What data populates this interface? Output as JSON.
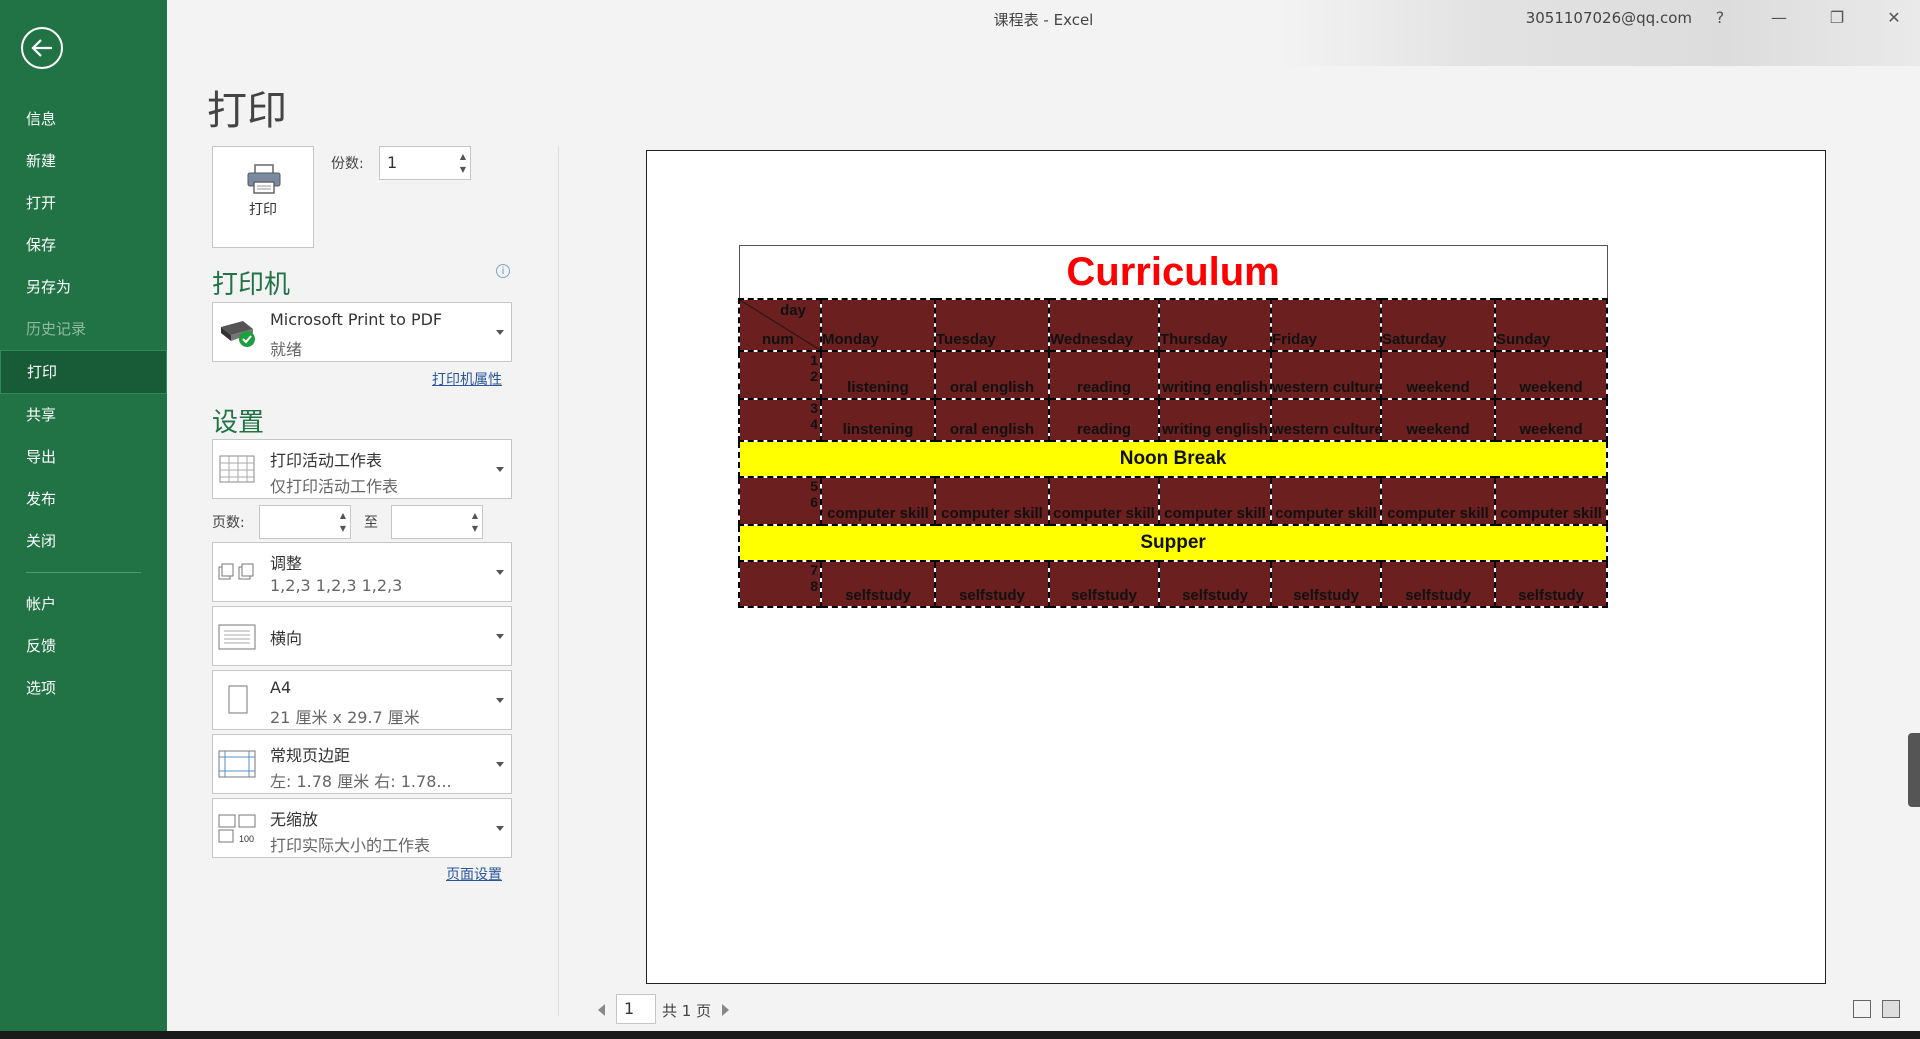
{
  "window": {
    "title": "课程表  -  Excel",
    "user": "3051107026@qq.com",
    "help": "?",
    "minimize": "—",
    "restore": "❐",
    "close": "✕"
  },
  "sidebar": {
    "items": [
      {
        "label": "信息"
      },
      {
        "label": "新建"
      },
      {
        "label": "打开"
      },
      {
        "label": "保存"
      },
      {
        "label": "另存为"
      },
      {
        "label": "历史记录"
      },
      {
        "label": "打印"
      },
      {
        "label": "共享"
      },
      {
        "label": "导出"
      },
      {
        "label": "发布"
      },
      {
        "label": "关闭"
      },
      {
        "label": "帐户"
      },
      {
        "label": "反馈"
      },
      {
        "label": "选项"
      }
    ]
  },
  "print": {
    "page_title": "打印",
    "button_label": "打印",
    "copies_label": "份数:",
    "copies_value": "1"
  },
  "printer": {
    "heading": "打印机",
    "name": "Microsoft Print to PDF",
    "status": "就绪",
    "properties_link": "打印机属性"
  },
  "settings": {
    "heading": "设置",
    "what": {
      "line1": "打印活动工作表",
      "line2": "仅打印活动工作表"
    },
    "pages_label": "页数:",
    "to_label": "至",
    "collate": {
      "line1": "调整",
      "line2": "1,2,3    1,2,3    1,2,3"
    },
    "orientation": "横向",
    "paper": {
      "line1": "A4",
      "line2": "21 厘米 x 29.7 厘米"
    },
    "margins": {
      "line1": "常规页边距",
      "line2": "左:  1.78 厘米    右:  1.78..."
    },
    "scaling": {
      "line1": "无缩放",
      "line2": "打印实际大小的工作表"
    },
    "page_setup_link": "页面设置"
  },
  "preview": {
    "title": "Curriculum",
    "header": {
      "day": "day",
      "num": "num",
      "days": [
        "Monday",
        "Tuesday",
        "Wednesday",
        "Thursday",
        "Friday",
        "Saturday",
        "Sunday"
      ]
    },
    "rows": [
      {
        "num": "1",
        "cells": [
          "",
          "",
          "",
          "",
          "",
          "",
          ""
        ]
      },
      {
        "num": "2",
        "cells": [
          "listening",
          "oral english",
          "reading",
          "writing english",
          "western culture",
          "weekend",
          "weekend"
        ]
      },
      {
        "num": "3",
        "cells": [
          "",
          "",
          "",
          "",
          "",
          "",
          ""
        ]
      },
      {
        "num": "4",
        "cells": [
          "linstening",
          "oral english",
          "reading",
          "writing english",
          "western culture",
          "weekend",
          "weekend"
        ]
      },
      {
        "band": "Noon Break"
      },
      {
        "num": "5",
        "cells": [
          "",
          "",
          "",
          "",
          "",
          "",
          ""
        ]
      },
      {
        "num": "6",
        "cells": [
          "computer skill",
          "computer skill",
          "computer skill",
          "computer skill",
          "computer skill",
          "computer skill",
          "computer skill"
        ]
      },
      {
        "band": "Supper"
      },
      {
        "num": "7",
        "cells": [
          "",
          "",
          "",
          "",
          "",
          "",
          ""
        ]
      },
      {
        "num": "8",
        "cells": [
          "selfstudy",
          "selfstudy",
          "selfstudy",
          "selfstudy",
          "selfstudy",
          "selfstudy",
          "selfstudy"
        ]
      }
    ]
  },
  "pager": {
    "current": "1",
    "total": "共 1 页"
  },
  "colors": {
    "accent": "#217346",
    "sheet_fill": "#6b1f1f",
    "band": "#ffff00",
    "title": "#ff0000"
  }
}
